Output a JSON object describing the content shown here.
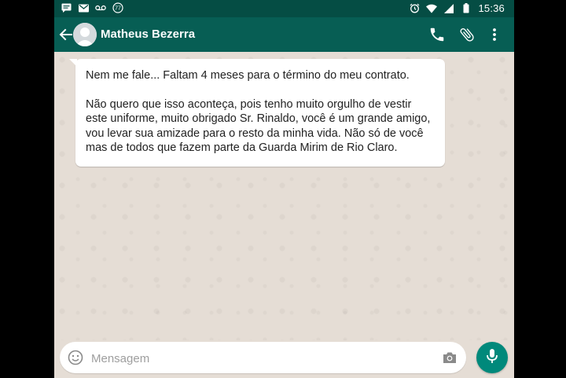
{
  "status_bar": {
    "time": "15:36",
    "left_icons": [
      "message-icon",
      "gmail-icon",
      "voicemail-icon",
      "notification-77-icon"
    ],
    "notification_count": "77",
    "right_icons": [
      "alarm-icon",
      "wifi-icon",
      "signal-icon",
      "battery-icon"
    ]
  },
  "header": {
    "contact_name": "Matheus Bezerra",
    "icons": [
      "back-arrow-icon",
      "phone-icon",
      "attach-icon",
      "more-vert-icon"
    ]
  },
  "chat": {
    "message": {
      "paragraphs": [
        "Nem me fale... Faltam 4 meses para o término do meu contrato.",
        "Não quero que isso aconteça, pois tenho muito orgulho de vestir este uniforme, muito obrigado Sr. Rinaldo, você é um grande amigo, vou levar sua amizade para o resto da minha vida. Não só de você mas de todos que fazem parte da Guarda Mirim de Rio Claro."
      ]
    }
  },
  "composer": {
    "placeholder": "Mensagem",
    "value": ""
  },
  "colors": {
    "status_bar": "#054d44",
    "header": "#075e54",
    "chat_background": "#e5ddd5",
    "mic_button": "#00897b"
  }
}
